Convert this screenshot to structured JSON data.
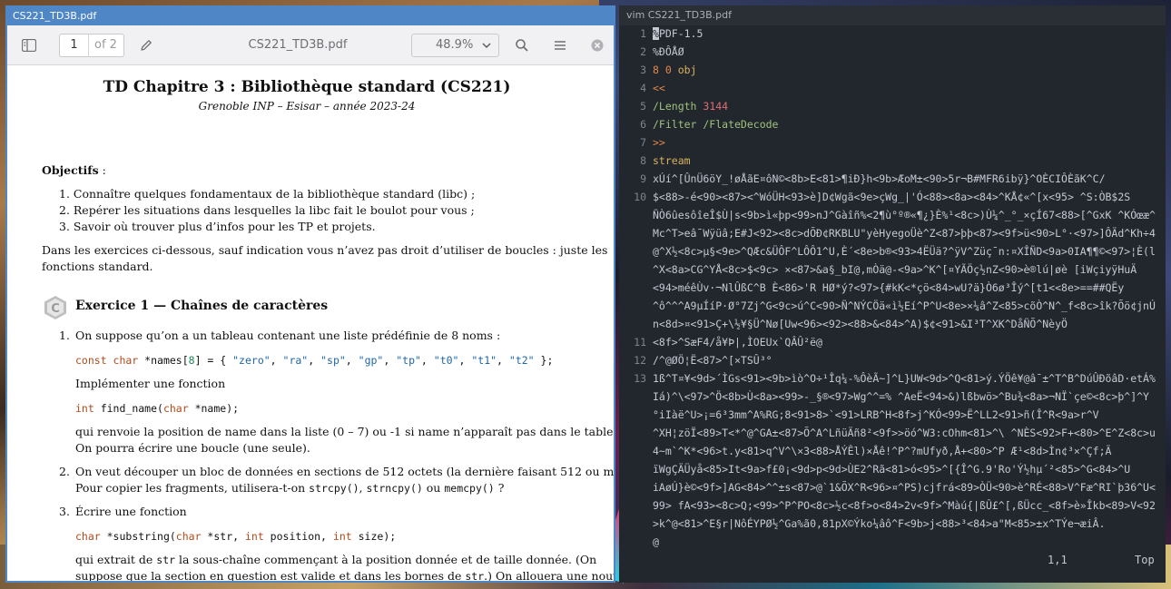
{
  "pdf_window": {
    "title": "CS221_TD3B.pdf",
    "toolbar": {
      "page_current": "1",
      "page_total": "of 2",
      "doc_name": "CS221_TD3B.pdf",
      "zoom": "48.9%"
    },
    "page": {
      "title": "TD Chapitre 3 : Bibliothèque standard (CS221)",
      "subtitle": "Grenoble INP – Esisar – année 2023-24",
      "objectifs_label": "Objectifs",
      "objectifs_colon": " :",
      "objectifs": [
        "1.  Connaître quelques fondamentaux de la bibliothèque standard (libc) ;",
        "2.  Repérer les situations dans lesquelles la libc fait le boulot pour vous ;",
        "3.  Savoir où trouver plus d’infos pour les TP et projets."
      ],
      "intro_line1": "Dans les exercices ci-dessous, sauf indication vous n’avez pas droit d’utiliser de boucles : juste les",
      "intro_line2": "fonctions standard.",
      "exercise_icon_letter": "C",
      "exercise_title": "Exercice 1 — Chaînes de caractères",
      "q1_num": "1.",
      "q1_text": "On suppose qu’on a un tableau contenant une liste prédéfinie de 8 noms :",
      "q1_code": {
        "kw1": "const char",
        "rest1": " *names[",
        "n8": "8",
        "rest2": "] = { ",
        "s1": "\"zero\"",
        "s2": "\"ra\"",
        "s3": "\"sp\"",
        "s4": "\"gp\"",
        "s5": "\"tp\"",
        "s6": "\"t0\"",
        "s7": "\"t1\"",
        "s8": "\"t2\"",
        "end": " };"
      },
      "q1_impl": "Implémenter une fonction",
      "q1_sig": {
        "kw_int": "int",
        "name": " find_name(",
        "kw_char": "char",
        "rest": " *name);"
      },
      "q1_desc1": "qui renvoie la position de name dans la liste (0 – 7) ou -1 si name n’apparaît pas dans le tableau.",
      "q1_desc2": "On pourra écrire une boucle (une seule).",
      "q2_num": "2.",
      "q2_text1": "On veut découper un bloc de données en sections de 512 octets (la dernière faisant 512 ou moins).",
      "q2_text2_pre": "Pour copier les fragments, utilisera-t-on ",
      "q2_c1": "strcpy()",
      "q2_sep1": ", ",
      "q2_c2": "strncpy()",
      "q2_sep2": " ou ",
      "q2_c3": "memcpy()",
      "q2_end": " ?",
      "q3_num": "3.",
      "q3_text": "Écrire une fonction",
      "q3_sig": {
        "kw_char": "char",
        "rest1": " *substring(",
        "kw_char2": "char",
        "rest2": " *str, ",
        "kw_int": "int",
        "rest3": " position, ",
        "kw_int2": "int",
        "rest4": " size);"
      },
      "q3_desc1_pre": "qui extrait de ",
      "q3_desc1_code": "str",
      "q3_desc1_post": " la sous-chaîne commençant à la position donnée et de taille donnée.  (On",
      "q3_desc2_pre": "suppose que la section en question est valide et dans les bornes de ",
      "q3_desc2_code": "str",
      "q3_desc2_post": ".) On allouera une nouvelle"
    }
  },
  "vim_window": {
    "title": "vim CS221_TD3B.pdf",
    "lines": [
      {
        "n": "1",
        "parts": [
          {
            "t": "%",
            "c": "cursor"
          },
          {
            "t": "PDF-1.5",
            "c": ""
          }
        ]
      },
      {
        "n": "2",
        "parts": [
          {
            "t": "%ÐÔÅØ",
            "c": ""
          }
        ]
      },
      {
        "n": "3",
        "parts": [
          {
            "t": "8 0",
            "c": "orange"
          },
          {
            "t": " obj",
            "c": "yellow"
          }
        ]
      },
      {
        "n": "4",
        "parts": [
          {
            "t": "<<",
            "c": "orange"
          }
        ]
      },
      {
        "n": "5",
        "parts": [
          {
            "t": "/Length ",
            "c": "green"
          },
          {
            "t": "3144",
            "c": "red"
          }
        ]
      },
      {
        "n": "6",
        "parts": [
          {
            "t": "/Filter /FlateDecode",
            "c": "green"
          }
        ]
      },
      {
        "n": "7",
        "parts": [
          {
            "t": ">>",
            "c": "orange"
          }
        ]
      },
      {
        "n": "8",
        "parts": [
          {
            "t": "stream",
            "c": "yellow"
          }
        ]
      },
      {
        "n": "9",
        "parts": [
          {
            "t": "xÚí^[ÛnÜ6öY_!øÅãE¤ôN©<8b>E<81>¶iÐ}h<9b>ÆoM±<90>5r¬B#MFR6ibÿ}^OÈCIÔÈãK^C/",
            "c": ""
          }
        ]
      },
      {
        "n": "10",
        "parts": [
          {
            "t": "$<88>-é<90><87><^WóÜH<93>è]D¢Wgã<9e>çWg_|'Ó<88><8a><84>^KÅ¢«^[x<95>    ^S:ÒB$2S",
            "c": ""
          }
        ]
      },
      {
        "n": "",
        "parts": [
          {
            "t": "ÑÒ6ûesôîeÎ$Ù|s<9b>ì«þp<99>nJ^Gàîñ%<2¶ù°º®«¶¿}È%¹<8c>)Ù¼^_°_×çÍ67<88>[^GxK ^KÓœæ^",
            "c": ""
          }
        ]
      },
      {
        "n": "",
        "parts": [
          {
            "t": "Mc^T>eâ¯Wÿüâ;E#J<92><8c>dÕÐ¢RKBLU\"yèHyegoÜè^Z<87>þþ<87><9f>ü<90>L°·<97>]ÔÄd^Kh÷4",
            "c": ""
          }
        ]
      },
      {
        "n": "",
        "parts": [
          {
            "t": "@^X½<8c>µ§<9e>^QÆc&ÜÔF^LÔÔ1^U,È´<8e>b®<93>4ËÜä?^ÿV^Züç¯n:¤XÎÑD<9a>0IA¶¶©<97>¦È(l",
            "c": ""
          }
        ]
      },
      {
        "n": "",
        "parts": [
          {
            "t": "^X<8a>CG^YÅ<8c>$<9c>    ×<87>&a§_bI@,mÒä@-<9a>^K^[¤YÃÖç½nZ<90>è®lú|øè [iWçiyÿHuÄ",
            "c": ""
          }
        ]
      },
      {
        "n": "",
        "parts": [
          {
            "t": "<94>méêÙv·¬NlÛßC^B      È<86>'R HØ*ý?<97>{#kK<*çö<84>wU?ä}Ò6ø³Îý^[t1<<8e>==##QËy",
            "c": ""
          }
        ]
      },
      {
        "n": "",
        "parts": [
          {
            "t": "^ô^^^A9µÍíP·Ø°7Zj^G<9c>ú^C<90>Ñ^NÝCÖä«ì½Eí^P^U<8e>×¼â^Z<85>cõÒ^N^_f<8c>îk?Õö¢jnÚ",
            "c": ""
          }
        ]
      },
      {
        "n": "",
        "parts": [
          {
            "t": "n<8d>¤<91>Ç+\\½¥§Ü^Nø[Uw<96><92><88>&<84>^A)$¢<91>&I³T^XK^DåÑÕ^NèyÖ",
            "c": ""
          }
        ]
      },
      {
        "n": "11",
        "parts": [
          {
            "t": "<8f>^SæF4/å¥Þ|,ÌOEUx`QÂÛ²ë@",
            "c": ""
          }
        ]
      },
      {
        "n": "12",
        "parts": [
          {
            "t": "/^@ØÖ¦Ë<87>^[×TSÛ³°",
            "c": ""
          }
        ]
      },
      {
        "n": "13",
        "parts": [
          {
            "t": "1ß^T¤¥<9d>´ÌGs<91><9b>ìò^O÷¹Îq¼-%ÔèÃ~]^L}UW<9d>^Q<81>ý.ÝÖê¥@â¯±^T^B^DúÛÐõâD·etÁ%",
            "c": ""
          }
        ]
      },
      {
        "n": "",
        "parts": [
          {
            "t": "Iá)^\\<97>^Ö<8b>Ù<8a><99>-_§®<97>Wg^^=%  ^AeË<94>&)lßbwö>^Bu¾<8a>¬NÏ`çe©<8c>þ^]^Y",
            "c": ""
          }
        ]
      },
      {
        "n": "",
        "parts": [
          {
            "t": "°iIàë^U>¡=6³3mm^A%RG;8<91>8>`<91>LRB^H<8f>j^KÓ<99>Ë^LL2<91>ñ(Î^R<9a>r^V",
            "c": ""
          }
        ]
      },
      {
        "n": "",
        "parts": [
          {
            "t": "^XH¦zöÏ<89>T<*^@^GA±<87>Õ^A^LñüÄñ8²<9f>>öó^W3:cOhm<81>^\\ ^NÈS<92>F+<80>^E^Z<8c>u",
            "c": ""
          }
        ]
      },
      {
        "n": "",
        "parts": [
          {
            "t": "4~m`^K*<96>t.y<81>q^V^\\×3<88>ÅÝÊl)×Åê!^P^?mUfyð,Å+<80>^P        Æ¹<8d>Ìn¢³×^Çf;Ä",
            "c": ""
          }
        ]
      },
      {
        "n": "",
        "parts": [
          {
            "t": "ïWgÇÄÜyå<85>It<9a>f£0¡<9d>p<9d>ÙE2^Rã<81>ó<95>^[{Î^G.9'Ro'Ý½hµ´²<85>^G<84>^U",
            "c": ""
          }
        ]
      },
      {
        "n": "",
        "parts": [
          {
            "t": "iAøÚ}è©<9f>]AG<84>^^±s<87>@`1&ÕX^R<96>¤^PS)cjfrá<89>ÒÜ<90>è^RÉ<88>V^Fæ^RI`þ36^U<",
            "c": ""
          }
        ]
      },
      {
        "n": "",
        "parts": [
          {
            "t": "99> fA<93><8c>Q;<99>^P^PO<8c>½c<8f>o<84>2v<9f>^Màú{|ßÛ£^[,ßÜcc_<8f>è»Îkb<89>V<92",
            "c": ""
          }
        ]
      },
      {
        "n": "",
        "parts": [
          {
            "t": ">k^@<81>^E§r|NôÉYPØ½^Ga%ã0,81pX©Ýko¼âô^F<9b>j<88>³<84>a\"M<85>±x^TÝe¬æiÂ.",
            "c": ""
          }
        ]
      },
      {
        "n": "",
        "parts": [
          {
            "t": "@",
            "c": ""
          }
        ]
      }
    ],
    "status": {
      "position": "1,1",
      "scroll": "Top"
    }
  }
}
